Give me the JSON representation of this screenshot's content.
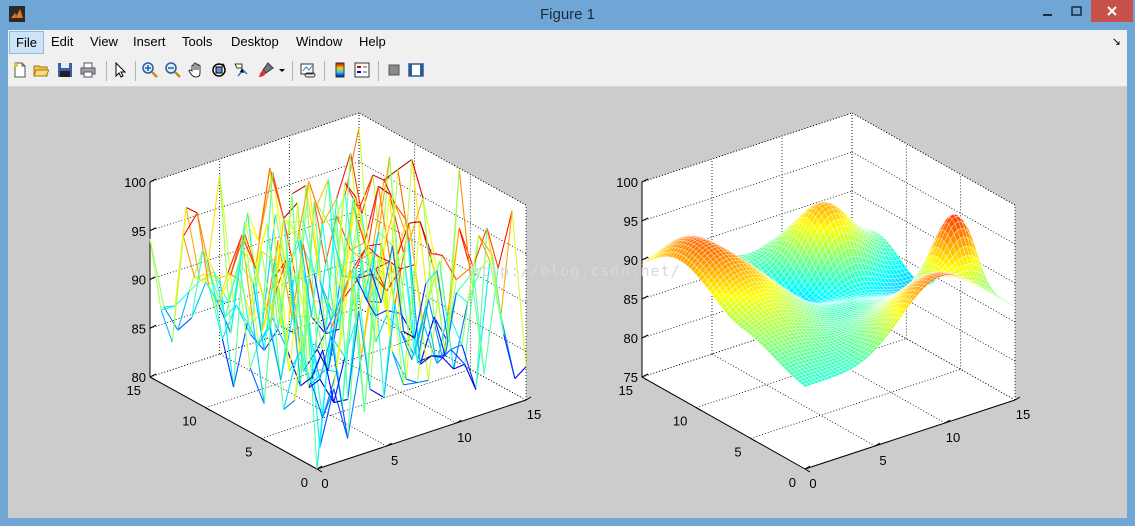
{
  "window": {
    "title": "Figure 1"
  },
  "menu": {
    "items": [
      {
        "id": "file",
        "label": "File"
      },
      {
        "id": "edit",
        "label": "Edit"
      },
      {
        "id": "view",
        "label": "View"
      },
      {
        "id": "insert",
        "label": "Insert"
      },
      {
        "id": "tools",
        "label": "Tools"
      },
      {
        "id": "desktop",
        "label": "Desktop"
      },
      {
        "id": "window",
        "label": "Window"
      },
      {
        "id": "help",
        "label": "Help"
      }
    ],
    "overflow_icon": "arrow-icon"
  },
  "toolbar": {
    "icons": [
      "new-figure-icon",
      "open-file-icon",
      "save-icon",
      "print-icon",
      "edit-plot-icon",
      "zoom-in-icon",
      "zoom-out-icon",
      "pan-icon",
      "rotate-3d-icon",
      "data-cursor-icon",
      "brush-icon",
      "brush-dropdown-icon",
      "link-plot-icon",
      "insert-colorbar-icon",
      "insert-legend-icon",
      "hide-plot-tools-icon",
      "show-plot-tools-icon"
    ]
  },
  "watermark": "http://blog.csdn.net/",
  "chart_data": [
    {
      "type": "mesh",
      "xlim": [
        0,
        15
      ],
      "ylim": [
        0,
        15
      ],
      "zlim": [
        80,
        100
      ],
      "xticks": [
        "0",
        "5",
        "10",
        "15"
      ],
      "yticks": [
        "0",
        "5",
        "10",
        "15"
      ],
      "zticks": [
        "80",
        "85",
        "90",
        "95",
        "100"
      ],
      "grid": true,
      "colormap": "jet"
    },
    {
      "type": "surface",
      "xlim": [
        0,
        15
      ],
      "ylim": [
        0,
        15
      ],
      "zlim": [
        75,
        100
      ],
      "xticks": [
        "0",
        "5",
        "10",
        "15"
      ],
      "yticks": [
        "0",
        "5",
        "10",
        "15"
      ],
      "zticks": [
        "75",
        "80",
        "85",
        "90",
        "95",
        "100"
      ],
      "grid": true,
      "colormap": "jet"
    }
  ]
}
